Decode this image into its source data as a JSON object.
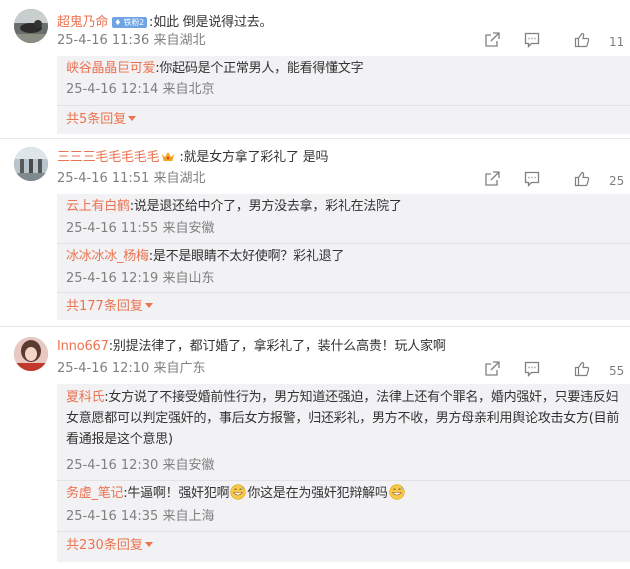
{
  "comments": [
    {
      "user": "超鬼乃命",
      "badge": "铁粉2",
      "text": ":如此 倒是说得过去。",
      "time": "25-4-16 11:36",
      "location": "来自湖北",
      "likes": "11",
      "replies": [
        {
          "user": "峡谷晶晶巨可爱",
          "text": ":你起码是个正常男人，能看得懂文字",
          "time": "25-4-16 12:14",
          "location": "来自北京"
        }
      ],
      "more": "共5条回复"
    },
    {
      "user": "三三三毛毛毛毛毛",
      "text": ":就是女方拿了彩礼了 是吗",
      "time": "25-4-16 11:51",
      "location": "来自湖北",
      "likes": "25",
      "replies": [
        {
          "user": "云上有白鹤",
          "text": ":说是退还给中介了，男方没去拿，彩礼在法院了",
          "time": "25-4-16 11:55",
          "location": "来自安徽"
        },
        {
          "user": "冰冰冰冰_杨梅",
          "text": ":是不是眼睛不太好使啊？彩礼退了",
          "time": "25-4-16 12:19",
          "location": "来自山东"
        }
      ],
      "more": "共177条回复"
    },
    {
      "user": "Inno667",
      "text": ":别提法律了，都订婚了，拿彩礼了，装什么高贵！玩人家啊",
      "time": "25-4-16 12:10",
      "location": "来自广东",
      "likes": "55",
      "replies": [
        {
          "user": "夏科氏",
          "text": ":女方说了不接受婚前性行为，男方知道还强迫，法律上还有个罪名，婚内强奸，只要违反妇女意愿都可以判定强奸的，事后女方报警，归还彩礼，男方不收，男方母亲利用舆论攻击女方(目前看通报是这个意思)",
          "time": "25-4-16 12:30",
          "location": "来自安徽"
        },
        {
          "user": "务虚_笔记",
          "text_a": ":牛逼啊！强奸犯啊",
          "text_b": "你这是在为强奸犯辩解吗",
          "time": "25-4-16 14:35",
          "location": "来自上海"
        }
      ],
      "more": "共230条回复"
    }
  ],
  "icons": [
    "share-icon",
    "comment-icon",
    "like-icon",
    "vip-crown-icon",
    "grin-sweat-emoji"
  ],
  "colors": {
    "username": "#eb7350",
    "meta": "#808080",
    "reply_bg": "#f2f2f5",
    "badge": "#6fa3e2"
  }
}
